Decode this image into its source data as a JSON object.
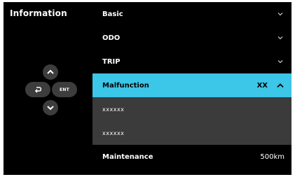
{
  "title": "Information",
  "dpad": {
    "enter_label": "ENT"
  },
  "menu": {
    "basic": "Basic",
    "odo": "ODO",
    "trip": "TRIP",
    "malfunction": {
      "label": "Malfunction",
      "value": "XX"
    },
    "sub_items": [
      "xxxxxx",
      "xxxxxx"
    ],
    "maintenance": {
      "label": "Maintenance",
      "value": "500km"
    }
  },
  "colors": {
    "highlight": "#3cc6e8",
    "submenu_bg": "#3b3b3b",
    "key_bg": "#3d3d3d"
  }
}
